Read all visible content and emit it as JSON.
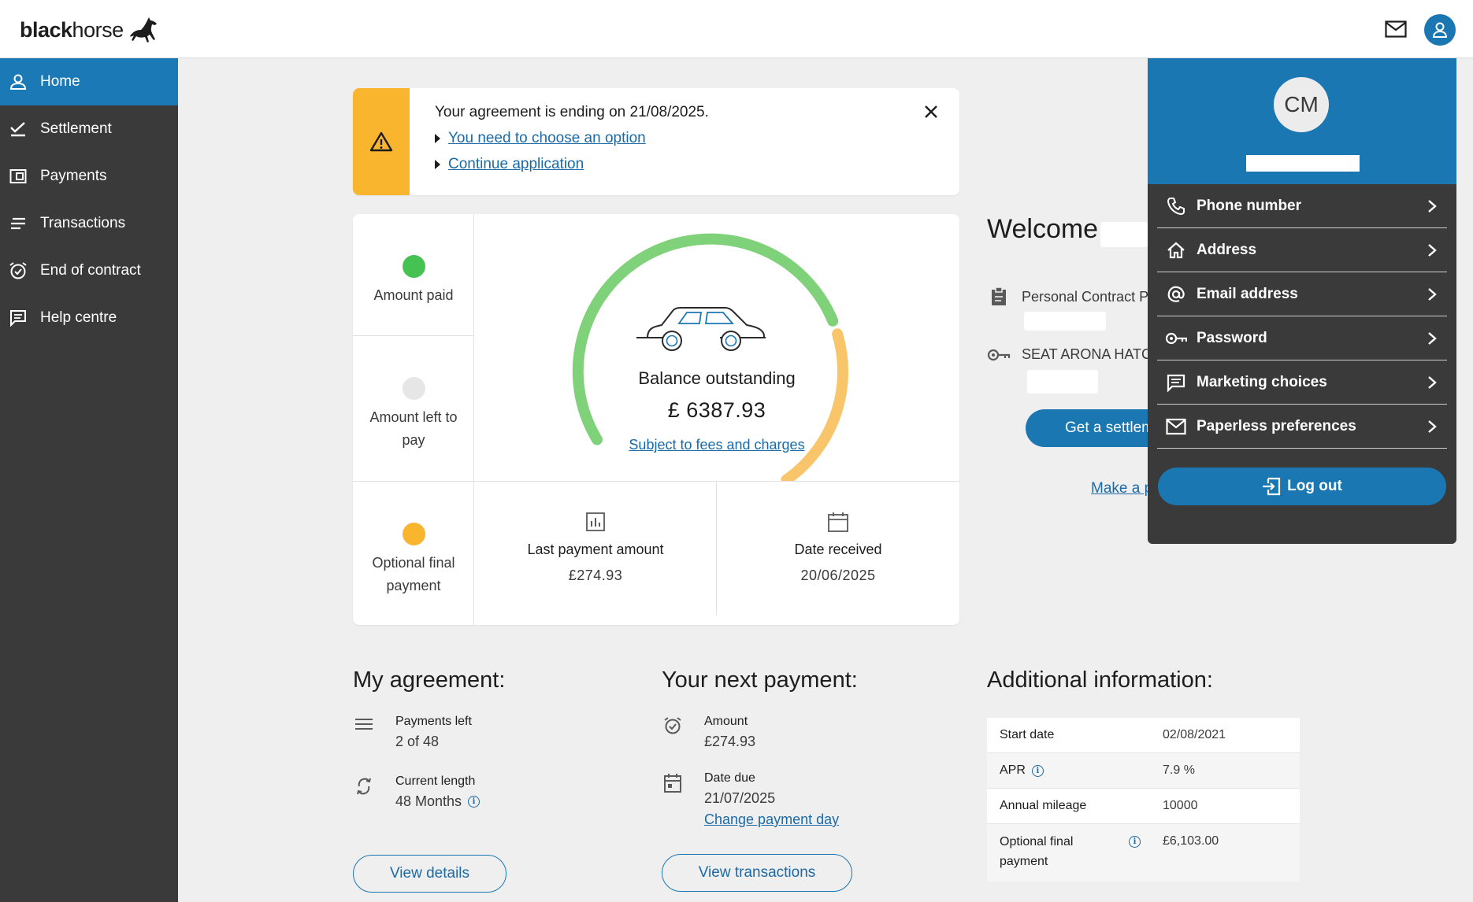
{
  "brand": {
    "name_bold": "black",
    "name_light": "horse"
  },
  "nav": {
    "items": [
      {
        "label": "Home",
        "icon": "person-icon"
      },
      {
        "label": "Settlement",
        "icon": "check-list-icon"
      },
      {
        "label": "Payments",
        "icon": "wallet-icon"
      },
      {
        "label": "Transactions",
        "icon": "lines-icon"
      },
      {
        "label": "End of contract",
        "icon": "alarm-icon"
      },
      {
        "label": "Help centre",
        "icon": "chat-icon"
      }
    ]
  },
  "alert": {
    "title": "Your agreement is ending on 21/08/2025.",
    "link1": "You need to choose an option",
    "link2": "Continue application"
  },
  "summary": {
    "legend": {
      "paid": "Amount paid",
      "left": "Amount left to pay",
      "final": "Optional final payment"
    },
    "balance_label": "Balance outstanding",
    "balance_value": "£ 6387.93",
    "fees_link": "Subject to fees and charges",
    "last_payment_label": "Last payment amount",
    "last_payment_value": "£274.93",
    "date_received_label": "Date received",
    "date_received_value": "20/06/2025",
    "gauge": {
      "paid_fraction": 0.72,
      "final_fraction": 0.28
    }
  },
  "welcome": {
    "greeting": "Welcome",
    "product": "Personal Contract P",
    "vehicle": "SEAT ARONA HATC",
    "settlement_button": "Get a settlem",
    "make_link": "Make a p"
  },
  "account_menu": {
    "initials": "CM",
    "items": [
      {
        "label": "Phone number",
        "icon": "phone-icon"
      },
      {
        "label": "Address",
        "icon": "home-icon"
      },
      {
        "label": "Email address",
        "icon": "at-icon"
      },
      {
        "label": "Password",
        "icon": "key-icon"
      },
      {
        "label": "Marketing choices",
        "icon": "message-icon"
      },
      {
        "label": "Paperless preferences",
        "icon": "mail-icon"
      }
    ],
    "logout": "Log out"
  },
  "agreement": {
    "title": "My agreement:",
    "payments_left_label": "Payments left",
    "payments_left_value": "2 of 48",
    "current_length_label": "Current length",
    "current_length_value": "48 Months",
    "button": "View details"
  },
  "next_payment": {
    "title": "Your next payment:",
    "amount_label": "Amount",
    "amount_value": "£274.93",
    "date_due_label": "Date due",
    "date_due_value": "21/07/2025",
    "change_link": "Change payment day",
    "button": "View transactions"
  },
  "additional": {
    "title": "Additional information:",
    "rows": [
      {
        "key": "Start date",
        "value": "02/08/2021"
      },
      {
        "key": "APR",
        "value": "7.9 %"
      },
      {
        "key": "Annual mileage",
        "value": "10000"
      },
      {
        "key": "Optional final payment",
        "value": "£6,103.00"
      }
    ]
  },
  "colors": {
    "primary": "#1b77b2",
    "sidebar": "#3a3a3a",
    "paid_green": "#7fd17a",
    "final_amber": "#f9c56a",
    "alert_amber": "#f9b52e"
  }
}
